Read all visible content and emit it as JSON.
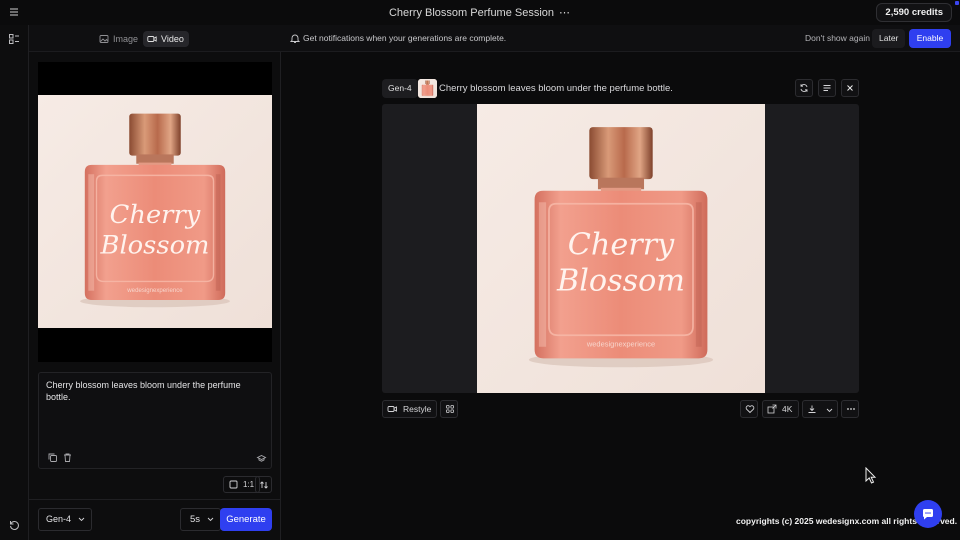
{
  "app": {
    "session_title": "Cherry Blossom Perfume Session",
    "session_menu": "⋯",
    "credits": "2,590 credits"
  },
  "subbar": {
    "tabs": [
      {
        "label": "Image",
        "icon": "image-icon",
        "active": false
      },
      {
        "label": "Video",
        "icon": "video-icon",
        "active": true
      }
    ],
    "notification": "Get notifications when your generations are complete.",
    "dont_show_again": "Don't show again",
    "later": "Later",
    "enable": "Enable"
  },
  "composer": {
    "prompt": "Cherry blossom leaves bloom under the perfume bottle.",
    "aspect_ratio": "1:1",
    "model": "Gen-4",
    "duration": "5s",
    "generate": "Generate"
  },
  "result": {
    "model": "Gen-4",
    "prompt": "Cherry blossom leaves bloom under the perfume bottle.",
    "restyle": "Restyle",
    "resolution": "4K"
  },
  "product": {
    "label_line1": "Cherry",
    "label_line2": "Blossom",
    "brand": "wedesignexperience"
  },
  "footer": {
    "copyright": "copyrights (c) 2025 wedesignx.com all rights reserved."
  },
  "colors": {
    "accent": "#2f3ff0",
    "background": "#0b0b0c",
    "bottle": "#e98a78",
    "cap": "#c97a5a"
  }
}
